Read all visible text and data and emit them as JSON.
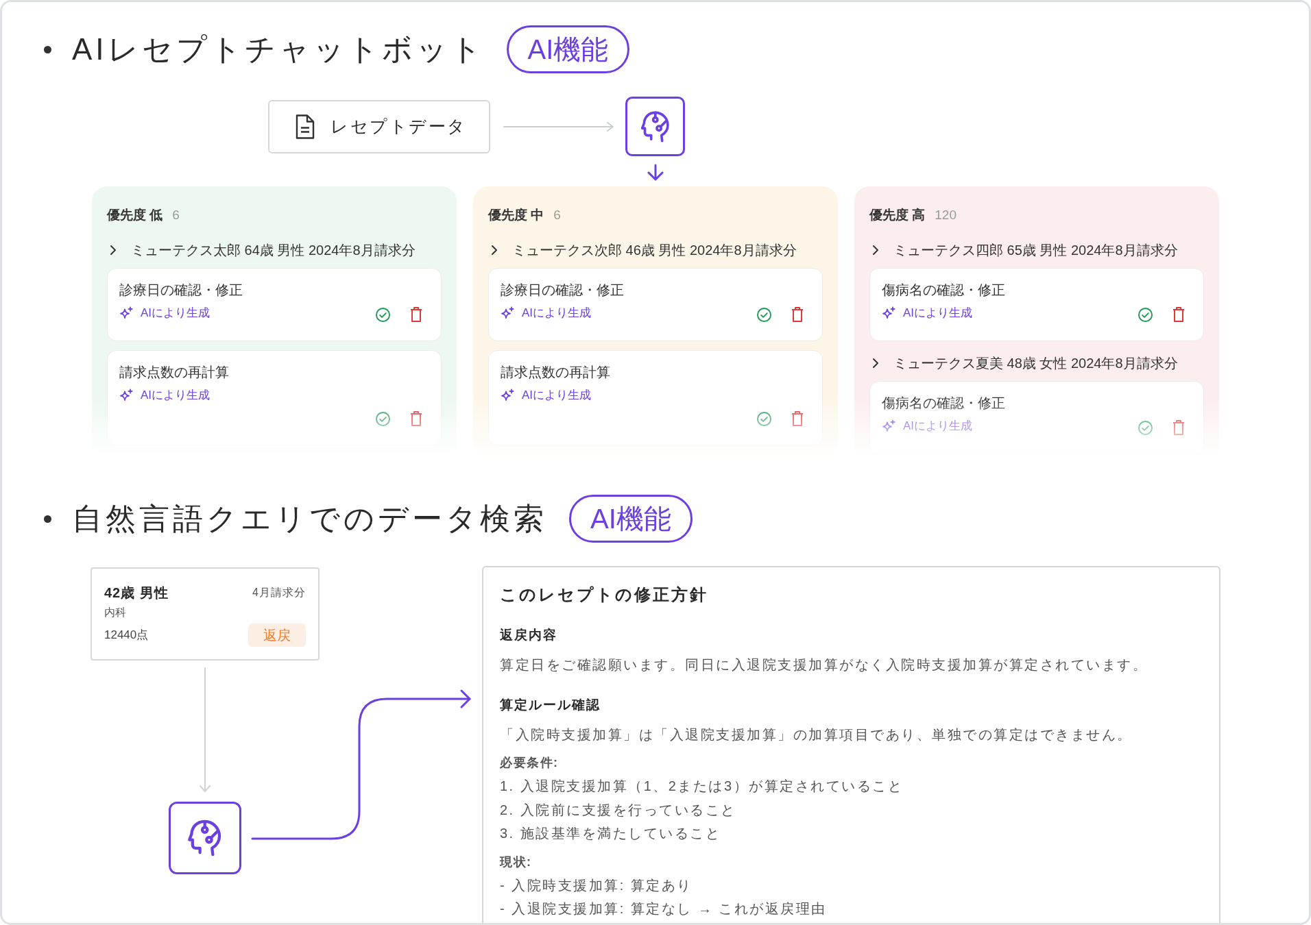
{
  "chatbot_section": {
    "title": "AIレセプトチャットボット",
    "badge": "AI機能",
    "source_node": {
      "label": "レセプトデータ"
    },
    "columns": [
      {
        "label": "優先度 低",
        "count": "6",
        "color": "#eef8f2",
        "groups": [
          {
            "patient": "ミューテクス太郎 64歳 男性 2024年8月請求分",
            "tasks": [
              {
                "title": "診療日の確認・修正",
                "tag": "AIにより生成"
              },
              {
                "title": "請求点数の再計算",
                "tag": "AIにより生成"
              }
            ]
          }
        ]
      },
      {
        "label": "優先度 中",
        "count": "6",
        "color": "#fdf6e8",
        "groups": [
          {
            "patient": "ミューテクス次郎 46歳 男性 2024年8月請求分",
            "tasks": [
              {
                "title": "診療日の確認・修正",
                "tag": "AIにより生成"
              },
              {
                "title": "請求点数の再計算",
                "tag": "AIにより生成"
              }
            ]
          }
        ]
      },
      {
        "label": "優先度 高",
        "count": "120",
        "color": "#fcedee",
        "groups": [
          {
            "patient": "ミューテクス四郎 65歳 男性 2024年8月請求分",
            "tasks": [
              {
                "title": "傷病名の確認・修正",
                "tag": "AIにより生成"
              }
            ]
          },
          {
            "patient": "ミューテクス夏美 48歳 女性 2024年8月請求分",
            "tasks": [
              {
                "title": "傷病名の確認・修正",
                "tag": "AIにより生成"
              }
            ]
          }
        ]
      }
    ]
  },
  "query_section": {
    "title": "自然言語クエリでのデータ検索",
    "badge": "AI機能",
    "patient_card": {
      "title": "42歳 男性",
      "period": "4月請求分",
      "department": "内科",
      "points": "12440点",
      "status": "返戻"
    },
    "result_card": {
      "title": "このレセプトの修正方針",
      "blocks": [
        {
          "kind": "heading",
          "text": "返戻内容"
        },
        {
          "kind": "paragraph",
          "text": "算定日をご確認願います。同日に入退院支援加算がなく入院時支援加算が算定されています。"
        },
        {
          "kind": "heading",
          "text": "算定ルール確認"
        },
        {
          "kind": "paragraph",
          "text": "「入院時支援加算」は「入退院支援加算」の加算項目であり、単独での算定はできません。"
        },
        {
          "kind": "label",
          "text": "必要条件:"
        },
        {
          "kind": "line",
          "text": "1. 入退院支援加算（1、2または3）が算定されていること"
        },
        {
          "kind": "line",
          "text": "2. 入院前に支援を行っていること"
        },
        {
          "kind": "line",
          "text": "3. 施設基準を満たしていること"
        },
        {
          "kind": "label",
          "text": "現状:"
        },
        {
          "kind": "line",
          "text": "- 入院時支援加算: 算定あり"
        },
        {
          "kind": "line",
          "text": "- 入退院支援加算: 算定なし → これが返戻理由"
        }
      ]
    }
  }
}
